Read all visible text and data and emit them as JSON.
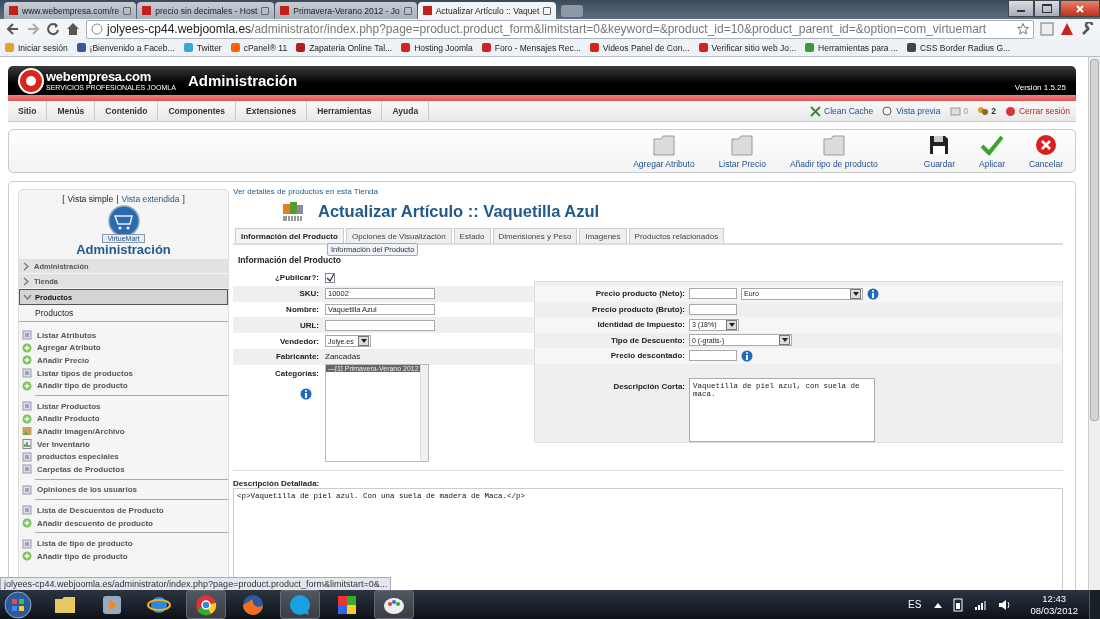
{
  "browser": {
    "tabs": [
      {
        "title": "www.webempresa.com/re",
        "selected": false
      },
      {
        "title": "precio sin decimales - Host",
        "selected": false
      },
      {
        "title": "Primavera-Verano 2012 - Jo",
        "selected": false
      },
      {
        "title": "Actualizar Artículo :: Vaquet",
        "selected": true
      }
    ],
    "url_host": "jolyees-cp44.webjoomla.es",
    "url_path": "/administrator/index.php?page=product.product_form&limitstart=0&keyword=&product_id=10&product_parent_id=&option=com_virtuemart",
    "bookmarks": [
      {
        "label": "Iniciar sesión",
        "color": "#e8a020"
      },
      {
        "label": "¡Bienvenido a Faceb...",
        "color": "#3b5998"
      },
      {
        "label": "Twitter",
        "color": "#33aadd"
      },
      {
        "label": "cPanel® 11",
        "color": "#ff6600"
      },
      {
        "label": "Zapateria Online Tal...",
        "color": "#b0201c"
      },
      {
        "label": "Hosting Joomla",
        "color": "#d0241c"
      },
      {
        "label": "Foro - Mensajes Rec...",
        "color": "#d0241c"
      },
      {
        "label": "Videos Panel de Con...",
        "color": "#d0241c"
      },
      {
        "label": "Verificar sitio web Jo...",
        "color": "#d0241c"
      },
      {
        "label": "Herramientas para ...",
        "color": "#3a9a3a"
      },
      {
        "label": "CSS Border Radius G...",
        "color": "#444444"
      }
    ]
  },
  "header": {
    "brand": "webempresa.com",
    "tagline": "SERVICIOS PROFESIONALES JOOMLA",
    "title": "Administración",
    "version": "Versión 1.5.25"
  },
  "menu": {
    "items": [
      "Sitio",
      "Menús",
      "Contenido",
      "Componentes",
      "Extensiones",
      "Herramientas",
      "Ayuda"
    ],
    "status": [
      {
        "label": "Clean Cache",
        "kind": "cache"
      },
      {
        "label": "Vista previa",
        "kind": "preview"
      },
      {
        "label": "0",
        "kind": "messages"
      },
      {
        "label": "2",
        "kind": "users"
      },
      {
        "label": "Cerrar sesión",
        "kind": "logout"
      }
    ]
  },
  "toolbar": [
    {
      "label": "Agregar Atributo",
      "kind": "folder"
    },
    {
      "label": "Listar Precio",
      "kind": "folder"
    },
    {
      "label": "Añadir tipo de producto",
      "kind": "folder"
    },
    {
      "label": "Guardar",
      "kind": "save"
    },
    {
      "label": "Aplicar",
      "kind": "apply"
    },
    {
      "label": "Cancelar",
      "kind": "cancel"
    }
  ],
  "sidebar": {
    "view_open": "[",
    "view_simple": "Vista simple",
    "view_sep": "|",
    "view_extended": "Vista extendida",
    "view_close": "]",
    "badge": "VirtueMart",
    "title": "Administración",
    "sections": [
      {
        "label": "Administración",
        "expanded": false,
        "selected": false
      },
      {
        "label": "Tienda",
        "expanded": false,
        "selected": false
      },
      {
        "label": "Productos",
        "expanded": true,
        "selected": true
      }
    ],
    "subitem": "Productos",
    "groups": [
      [
        {
          "label": "Listar Atributos",
          "kind": "list"
        },
        {
          "label": "Agregar Atributo",
          "kind": "add"
        },
        {
          "label": "Añadir Precio",
          "kind": "add"
        },
        {
          "label": "Listar tipos de productos",
          "kind": "list"
        },
        {
          "label": "Añadir tipo de producto",
          "kind": "add"
        }
      ],
      [
        {
          "label": "Listar Productos",
          "kind": "list"
        },
        {
          "label": "Añadir Producto",
          "kind": "add"
        },
        {
          "label": "Añadir Imagen/Archivo",
          "kind": "image"
        },
        {
          "label": "Ver Inventario",
          "kind": "inventory"
        },
        {
          "label": "productos especiales",
          "kind": "list"
        },
        {
          "label": "Carpetas de Productos",
          "kind": "list"
        }
      ],
      [
        {
          "label": "Opiniones de los usuarios",
          "kind": "list"
        }
      ],
      [
        {
          "label": "Lista de Descuentos de Producto",
          "kind": "list"
        },
        {
          "label": "Añadir descuento de producto",
          "kind": "add"
        }
      ],
      [
        {
          "label": "Lista de tipo de producto",
          "kind": "list"
        },
        {
          "label": "Añadir tipo de producto",
          "kind": "add"
        }
      ]
    ]
  },
  "main": {
    "top_link": "Ver detalles de productos en esta Tienda",
    "title": "Actualizar Artículo :: Vaquetilla Azul",
    "tabs": [
      {
        "label": "Información del Producto",
        "selected": true
      },
      {
        "label": "Opciones de Visualización",
        "selected": false
      },
      {
        "label": "Estado",
        "selected": false
      },
      {
        "label": "Dimensiones y Peso",
        "selected": false
      },
      {
        "label": "Imagenes",
        "selected": false
      },
      {
        "label": "Productos relacionados",
        "selected": false
      }
    ],
    "tooltip": "Información del Producto",
    "section_title": "Información del Producto",
    "left_fields": [
      {
        "label": "¿Publicar?:",
        "kind": "checkbox",
        "checked": true,
        "info": false
      },
      {
        "label": "SKU:",
        "kind": "text",
        "value": "10002",
        "info": false
      },
      {
        "label": "Nombre:",
        "kind": "text",
        "value": "Vaquetilla Azul",
        "info": false
      },
      {
        "label": "URL:",
        "kind": "text",
        "info": false
      },
      {
        "label": "Vendedor:",
        "kind": "select",
        "value": "Jolye.es",
        "info": false
      },
      {
        "label": "Fabricante:",
        "kind": "static",
        "value": "Zancadas",
        "info": false
      },
      {
        "label": "Categorías:",
        "kind": "listbox",
        "options": [
          {
            "label": "—[1] Primavera-Verano 2012",
            "selected": true
          }
        ],
        "info": true
      }
    ],
    "right_fields": [
      {
        "label": "Precio producto (Neto):",
        "kind": "text",
        "unit": "Euro",
        "info": true
      },
      {
        "label": "Precio producto (Bruto):",
        "kind": "text",
        "info": false
      },
      {
        "label": "Identidad de Impuesto:",
        "kind": "select",
        "value": "3 (18%)",
        "info": false
      },
      {
        "label": "Tipo de Descuento:",
        "kind": "select",
        "value": "0 (-gratis-)",
        "info": false
      },
      {
        "label": "Precio descontado:",
        "kind": "text",
        "info": true
      },
      {
        "label": "Descripción Corta:",
        "kind": "textarea",
        "value": "Vaquetilla de piel azul, con suela de maca.",
        "info": false
      }
    ],
    "detail_label": "Descripción Detallada:",
    "detail_value": "<p>Vaquetilla de piel azul. Con una suela de madera de Maca.</p>"
  },
  "status_url": "jolyees-cp44.webjoomla.es/administrator/index.php?page=product.product_form&limitstart=0&...",
  "taskbar": {
    "apps": [
      {
        "kind": "folder",
        "active": false
      },
      {
        "kind": "media",
        "active": false
      },
      {
        "kind": "ie",
        "active": false
      },
      {
        "kind": "chrome",
        "active": true
      },
      {
        "kind": "firefox",
        "active": false
      },
      {
        "kind": "skype",
        "active": true
      },
      {
        "kind": "google",
        "active": false
      },
      {
        "kind": "paint",
        "active": true
      }
    ],
    "language": "ES",
    "time": "12:43",
    "date": "08/03/2012"
  }
}
